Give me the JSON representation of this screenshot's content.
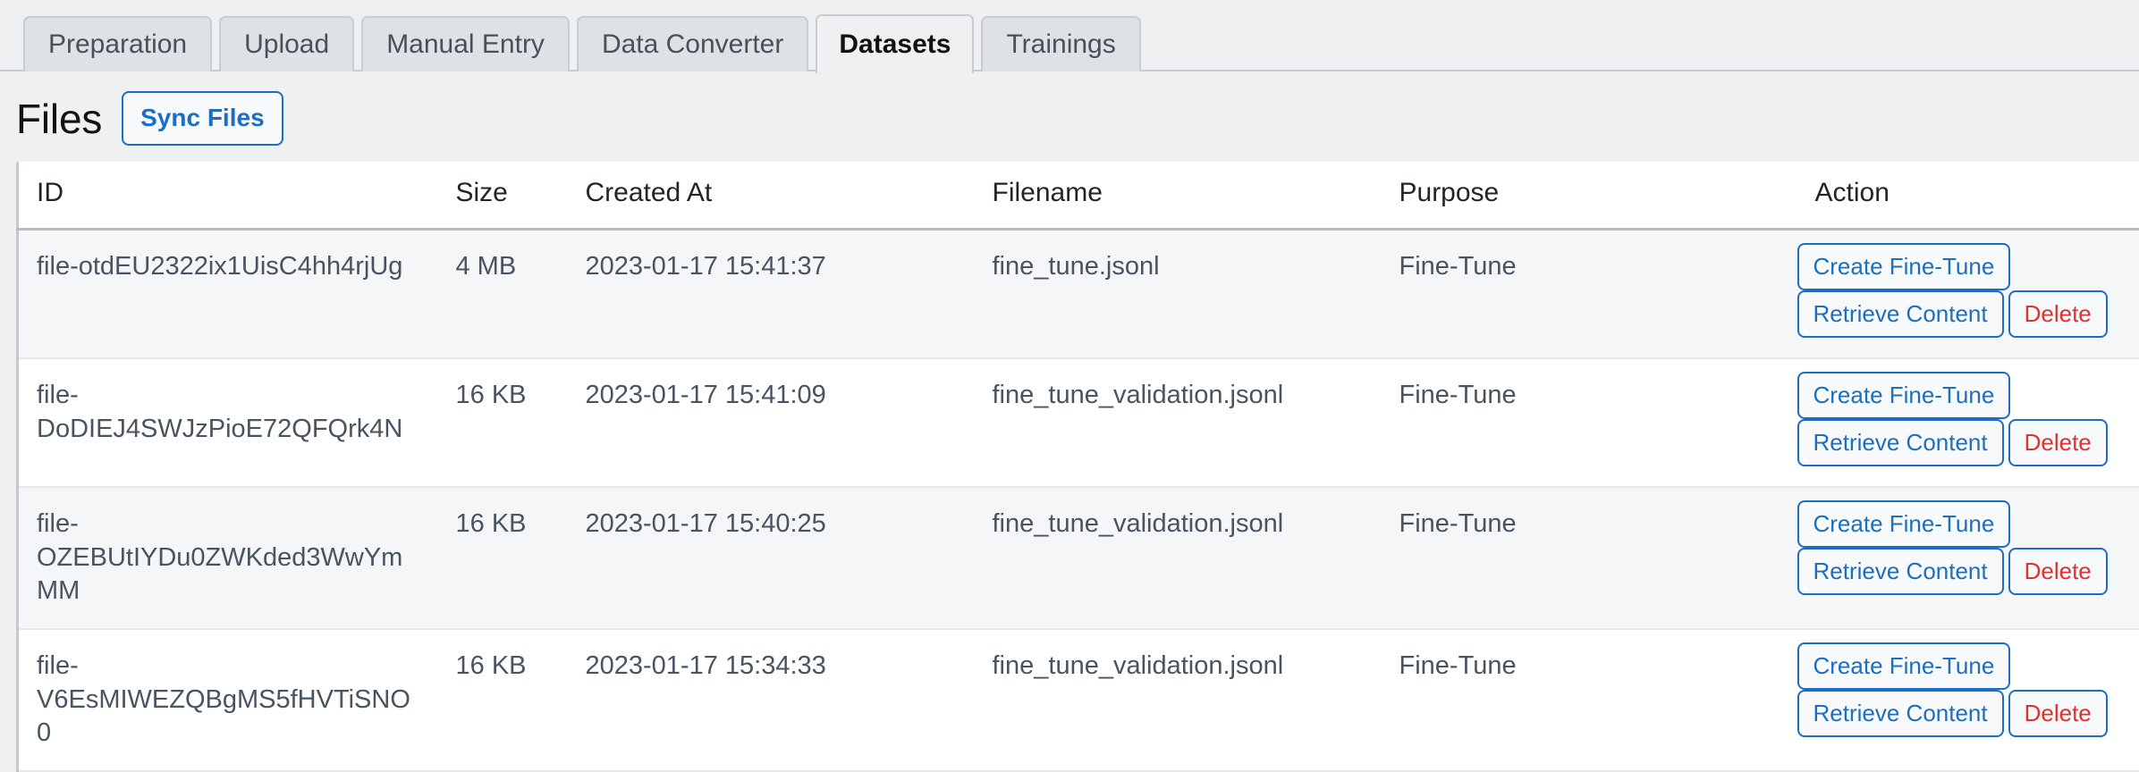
{
  "colors": {
    "page_bg": "#eff0f1",
    "accent_blue": "#1b6ec2",
    "danger_red": "#e03131",
    "tab_inactive_bg": "#dee2e6",
    "row_stripe": "#f5f6f7"
  },
  "tabs": [
    {
      "label": "Preparation",
      "active": false
    },
    {
      "label": "Upload",
      "active": false
    },
    {
      "label": "Manual Entry",
      "active": false
    },
    {
      "label": "Data Converter",
      "active": false
    },
    {
      "label": "Datasets",
      "active": true
    },
    {
      "label": "Trainings",
      "active": false
    }
  ],
  "section": {
    "title": "Files",
    "sync_button_label": "Sync Files"
  },
  "table": {
    "columns": [
      "ID",
      "Size",
      "Created At",
      "Filename",
      "Purpose",
      "Action"
    ],
    "row_actions": {
      "create_fine_tune": "Create Fine-Tune",
      "retrieve_content": "Retrieve Content",
      "delete": "Delete"
    },
    "rows": [
      {
        "id": "file-otdEU2322ix1UisC4hh4rjUg",
        "size": "4 MB",
        "created_at": "2023-01-17 15:41:37",
        "filename": "fine_tune.jsonl",
        "purpose": "Fine-Tune"
      },
      {
        "id": "file-DoDIEJ4SWJzPioE72QFQrk4N",
        "size": "16 KB",
        "created_at": "2023-01-17 15:41:09",
        "filename": "fine_tune_validation.jsonl",
        "purpose": "Fine-Tune"
      },
      {
        "id": "file-OZEBUtIYDu0ZWKded3WwYmMM",
        "size": "16 KB",
        "created_at": "2023-01-17 15:40:25",
        "filename": "fine_tune_validation.jsonl",
        "purpose": "Fine-Tune"
      },
      {
        "id": "file-V6EsMIWEZQBgMS5fHVTiSNO0",
        "size": "16 KB",
        "created_at": "2023-01-17 15:34:33",
        "filename": "fine_tune_validation.jsonl",
        "purpose": "Fine-Tune"
      }
    ]
  }
}
